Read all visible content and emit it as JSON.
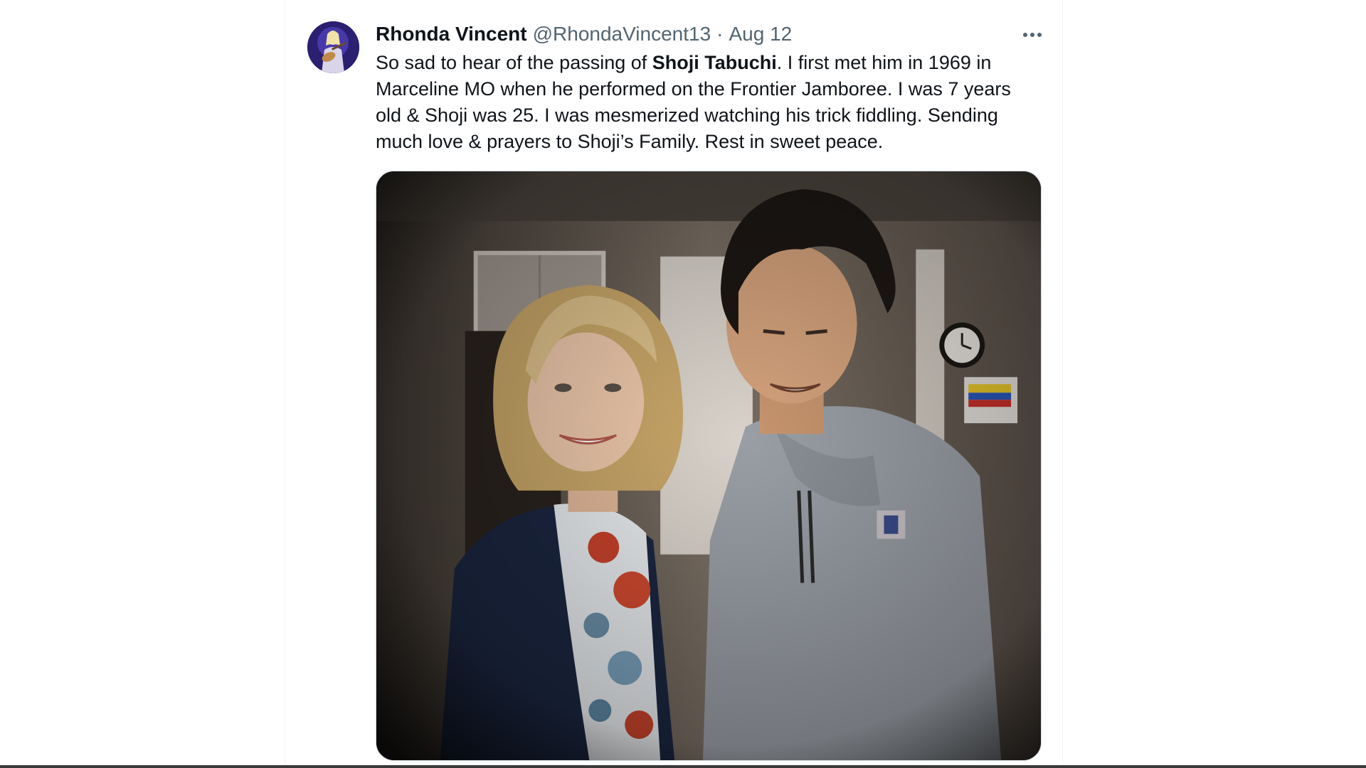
{
  "tweet": {
    "author": {
      "display_name": "Rhonda Vincent",
      "handle": "@RhondaVincent13",
      "separator": "·",
      "date": "Aug 12"
    },
    "text": {
      "before_mention": "So sad to hear of the passing of ",
      "mention": "Shoji Tabuchi",
      "after_mention": ".  I first met him in 1969 in Marceline MO when he performed on the Frontier Jamboree. I was 7 years old & Shoji was 25. I was mesmerized watching his trick fiddling. Sending much love & prayers to Shoji’s Family. Rest in sweet peace."
    },
    "more_icon": "more-horizontal-icon",
    "media": {
      "kind": "photo",
      "subject": "two people posing indoors"
    }
  },
  "colors": {
    "text_primary": "#0f1419",
    "text_secondary": "#536471",
    "border": "#cfd9de"
  }
}
